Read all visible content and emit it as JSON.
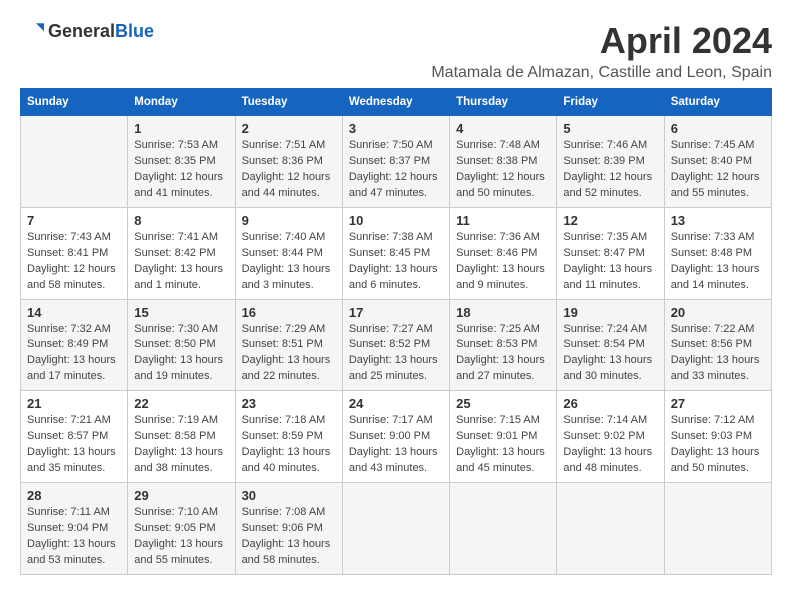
{
  "logo": {
    "general": "General",
    "blue": "Blue"
  },
  "title": "April 2024",
  "subtitle": "Matamala de Almazan, Castille and Leon, Spain",
  "headers": [
    "Sunday",
    "Monday",
    "Tuesday",
    "Wednesday",
    "Thursday",
    "Friday",
    "Saturday"
  ],
  "weeks": [
    [
      {
        "day": "",
        "info": ""
      },
      {
        "day": "1",
        "info": "Sunrise: 7:53 AM\nSunset: 8:35 PM\nDaylight: 12 hours\nand 41 minutes."
      },
      {
        "day": "2",
        "info": "Sunrise: 7:51 AM\nSunset: 8:36 PM\nDaylight: 12 hours\nand 44 minutes."
      },
      {
        "day": "3",
        "info": "Sunrise: 7:50 AM\nSunset: 8:37 PM\nDaylight: 12 hours\nand 47 minutes."
      },
      {
        "day": "4",
        "info": "Sunrise: 7:48 AM\nSunset: 8:38 PM\nDaylight: 12 hours\nand 50 minutes."
      },
      {
        "day": "5",
        "info": "Sunrise: 7:46 AM\nSunset: 8:39 PM\nDaylight: 12 hours\nand 52 minutes."
      },
      {
        "day": "6",
        "info": "Sunrise: 7:45 AM\nSunset: 8:40 PM\nDaylight: 12 hours\nand 55 minutes."
      }
    ],
    [
      {
        "day": "7",
        "info": "Sunrise: 7:43 AM\nSunset: 8:41 PM\nDaylight: 12 hours\nand 58 minutes."
      },
      {
        "day": "8",
        "info": "Sunrise: 7:41 AM\nSunset: 8:42 PM\nDaylight: 13 hours\nand 1 minute."
      },
      {
        "day": "9",
        "info": "Sunrise: 7:40 AM\nSunset: 8:44 PM\nDaylight: 13 hours\nand 3 minutes."
      },
      {
        "day": "10",
        "info": "Sunrise: 7:38 AM\nSunset: 8:45 PM\nDaylight: 13 hours\nand 6 minutes."
      },
      {
        "day": "11",
        "info": "Sunrise: 7:36 AM\nSunset: 8:46 PM\nDaylight: 13 hours\nand 9 minutes."
      },
      {
        "day": "12",
        "info": "Sunrise: 7:35 AM\nSunset: 8:47 PM\nDaylight: 13 hours\nand 11 minutes."
      },
      {
        "day": "13",
        "info": "Sunrise: 7:33 AM\nSunset: 8:48 PM\nDaylight: 13 hours\nand 14 minutes."
      }
    ],
    [
      {
        "day": "14",
        "info": "Sunrise: 7:32 AM\nSunset: 8:49 PM\nDaylight: 13 hours\nand 17 minutes."
      },
      {
        "day": "15",
        "info": "Sunrise: 7:30 AM\nSunset: 8:50 PM\nDaylight: 13 hours\nand 19 minutes."
      },
      {
        "day": "16",
        "info": "Sunrise: 7:29 AM\nSunset: 8:51 PM\nDaylight: 13 hours\nand 22 minutes."
      },
      {
        "day": "17",
        "info": "Sunrise: 7:27 AM\nSunset: 8:52 PM\nDaylight: 13 hours\nand 25 minutes."
      },
      {
        "day": "18",
        "info": "Sunrise: 7:25 AM\nSunset: 8:53 PM\nDaylight: 13 hours\nand 27 minutes."
      },
      {
        "day": "19",
        "info": "Sunrise: 7:24 AM\nSunset: 8:54 PM\nDaylight: 13 hours\nand 30 minutes."
      },
      {
        "day": "20",
        "info": "Sunrise: 7:22 AM\nSunset: 8:56 PM\nDaylight: 13 hours\nand 33 minutes."
      }
    ],
    [
      {
        "day": "21",
        "info": "Sunrise: 7:21 AM\nSunset: 8:57 PM\nDaylight: 13 hours\nand 35 minutes."
      },
      {
        "day": "22",
        "info": "Sunrise: 7:19 AM\nSunset: 8:58 PM\nDaylight: 13 hours\nand 38 minutes."
      },
      {
        "day": "23",
        "info": "Sunrise: 7:18 AM\nSunset: 8:59 PM\nDaylight: 13 hours\nand 40 minutes."
      },
      {
        "day": "24",
        "info": "Sunrise: 7:17 AM\nSunset: 9:00 PM\nDaylight: 13 hours\nand 43 minutes."
      },
      {
        "day": "25",
        "info": "Sunrise: 7:15 AM\nSunset: 9:01 PM\nDaylight: 13 hours\nand 45 minutes."
      },
      {
        "day": "26",
        "info": "Sunrise: 7:14 AM\nSunset: 9:02 PM\nDaylight: 13 hours\nand 48 minutes."
      },
      {
        "day": "27",
        "info": "Sunrise: 7:12 AM\nSunset: 9:03 PM\nDaylight: 13 hours\nand 50 minutes."
      }
    ],
    [
      {
        "day": "28",
        "info": "Sunrise: 7:11 AM\nSunset: 9:04 PM\nDaylight: 13 hours\nand 53 minutes."
      },
      {
        "day": "29",
        "info": "Sunrise: 7:10 AM\nSunset: 9:05 PM\nDaylight: 13 hours\nand 55 minutes."
      },
      {
        "day": "30",
        "info": "Sunrise: 7:08 AM\nSunset: 9:06 PM\nDaylight: 13 hours\nand 58 minutes."
      },
      {
        "day": "",
        "info": ""
      },
      {
        "day": "",
        "info": ""
      },
      {
        "day": "",
        "info": ""
      },
      {
        "day": "",
        "info": ""
      }
    ]
  ]
}
